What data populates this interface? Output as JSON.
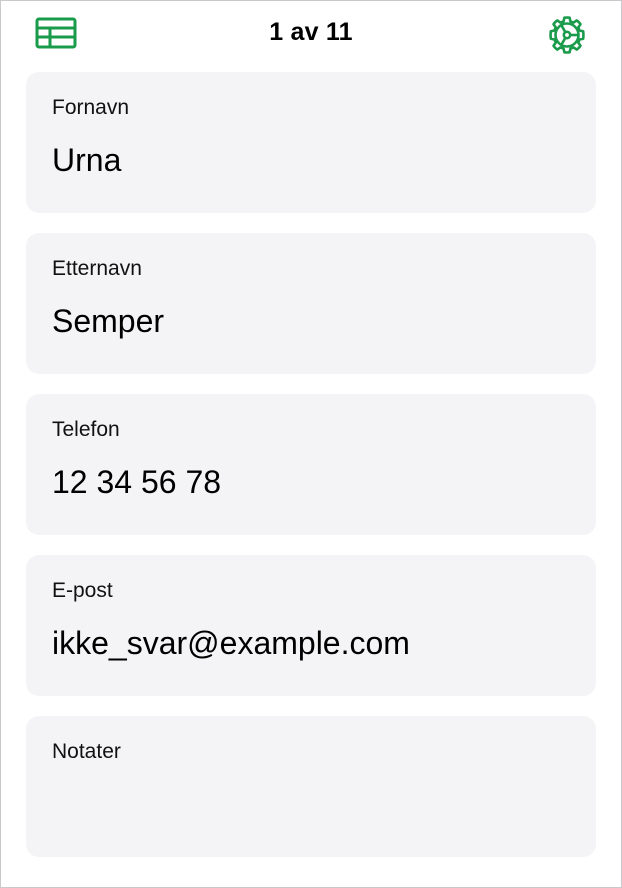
{
  "header": {
    "record_counter": "1 av 11",
    "table_icon": "table-grid-icon",
    "settings_icon": "gear-icon"
  },
  "fields": [
    {
      "label": "Fornavn",
      "value": "Urna"
    },
    {
      "label": "Etternavn",
      "value": "Semper"
    },
    {
      "label": "Telefon",
      "value": "12 34 56 78"
    },
    {
      "label": "E-post",
      "value": "ikke_svar@example.com"
    },
    {
      "label": "Notater",
      "value": ""
    }
  ],
  "colors": {
    "accent": "#1a9b4b",
    "card_background": "#f4f4f6"
  }
}
